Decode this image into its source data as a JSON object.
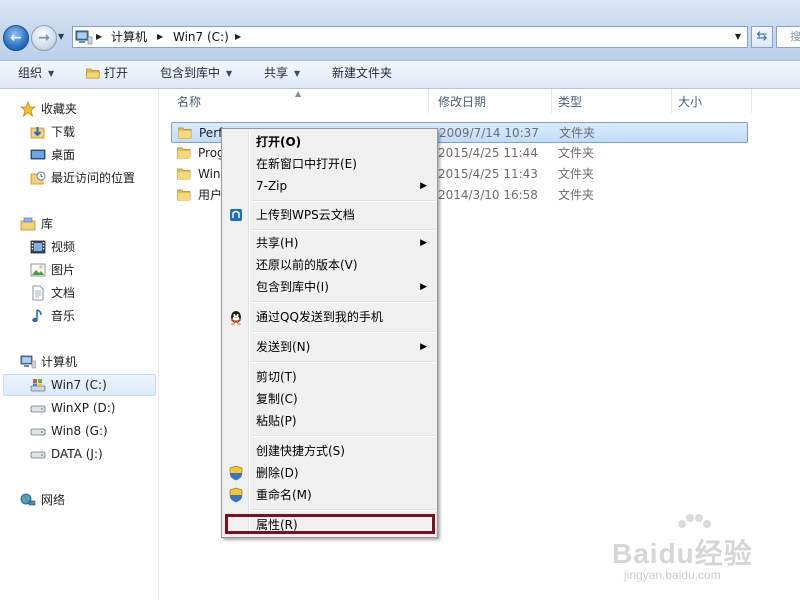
{
  "address_bar": {
    "crumbs": [
      "计算机",
      "Win7 (C:)"
    ],
    "search_placeholder": "搜"
  },
  "toolbar": {
    "organize": "组织",
    "open": "打开",
    "include_in_library": "包含到库中",
    "share": "共享",
    "new_folder": "新建文件夹"
  },
  "nav": {
    "favorites": "收藏夹",
    "favorites_items": [
      "下载",
      "桌面",
      "最近访问的位置"
    ],
    "libraries": "库",
    "libraries_items": [
      "视频",
      "图片",
      "文档",
      "音乐"
    ],
    "computer": "计算机",
    "drives": [
      "Win7 (C:)",
      "WinXP (D:)",
      "Win8 (G:)",
      "DATA (J:)"
    ],
    "network": "网络",
    "selected": "Win7 (C:)"
  },
  "columns": {
    "name": "名称",
    "modified": "修改日期",
    "type": "类型",
    "size": "大小"
  },
  "files": [
    {
      "name": "Perf",
      "modified": "2009/7/14 10:37",
      "type": "文件夹",
      "selected": true
    },
    {
      "name": "Prog",
      "modified": "2015/4/25 11:44",
      "type": "文件夹",
      "selected": false
    },
    {
      "name": "Win",
      "modified": "2015/4/25 11:43",
      "type": "文件夹",
      "selected": false
    },
    {
      "name": "用户",
      "modified": "2014/3/10 16:58",
      "type": "文件夹",
      "selected": false
    }
  ],
  "context_menu": {
    "open": "打开(O)",
    "open_new_window": "在新窗口中打开(E)",
    "seven_zip": "7-Zip",
    "upload_wps": "上传到WPS云文档",
    "share": "共享(H)",
    "restore_previous": "还原以前的版本(V)",
    "include_library": "包含到库中(I)",
    "send_qq": "通过QQ发送到我的手机",
    "send_to": "发送到(N)",
    "cut": "剪切(T)",
    "copy": "复制(C)",
    "paste": "粘贴(P)",
    "create_shortcut": "创建快捷方式(S)",
    "delete": "删除(D)",
    "rename": "重命名(M)",
    "properties": "属性(R)"
  },
  "watermark": {
    "logo": "Baidu经验",
    "url": "jingyan.baidu.com"
  },
  "colors": {
    "highlight_border": "#7b1020",
    "selection": "#c1dcfb",
    "menu_bg": "#f0f0f0"
  }
}
